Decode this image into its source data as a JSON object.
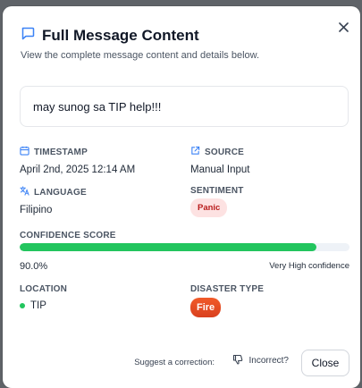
{
  "dialog": {
    "title": "Full Message Content",
    "subtitle": "View the complete message content and details below.",
    "message": "may sunog sa TIP help!!!"
  },
  "details": {
    "timestamp": {
      "label": "TIMESTAMP",
      "value": "April 2nd, 2025 12:14 AM",
      "icon": "calendar-icon"
    },
    "source": {
      "label": "SOURCE",
      "value": "Manual Input",
      "icon": "external-link-icon"
    },
    "language": {
      "label": "LANGUAGE",
      "value": "Filipino",
      "icon": "translate-icon"
    },
    "sentiment": {
      "label": "SENTIMENT",
      "value": "Panic"
    },
    "confidence": {
      "label": "CONFIDENCE SCORE",
      "value": "90.0%",
      "level": "Very High confidence",
      "fraction": 0.9
    },
    "location": {
      "label": "LOCATION",
      "value": "TIP"
    },
    "disaster_type": {
      "label": "DISASTER TYPE",
      "value": "Fire"
    }
  },
  "footer": {
    "suggest_label": "Suggest a correction:",
    "incorrect_label": "Incorrect?",
    "close_label": "Close"
  },
  "colors": {
    "accent": "#3b82f6",
    "confidence_bar": "#22c55e",
    "panic_bg": "#fde2e2",
    "panic_text": "#b91c1c",
    "fire": "#e84a23"
  }
}
